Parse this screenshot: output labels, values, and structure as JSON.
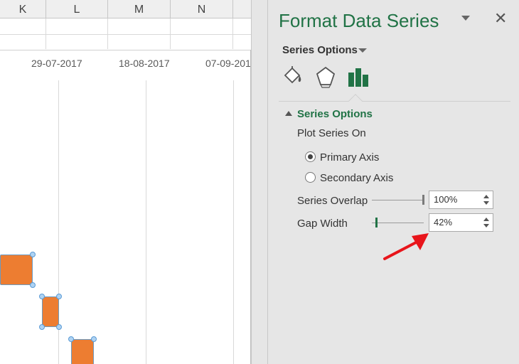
{
  "sheet": {
    "columns": [
      "K",
      "L",
      "M",
      "N"
    ],
    "chart": {
      "date_labels": [
        "29-07-2017",
        "18-08-2017",
        "07-09-201"
      ]
    },
    "colors": {
      "bar": "#ed7d31",
      "handle": "#5b9bd5"
    }
  },
  "pane": {
    "title": "Format Data Series",
    "close_glyph": "✕",
    "series_options_dropdown": "Series Options",
    "tabs": [
      {
        "name": "fill-line",
        "icon": "paint-bucket-icon"
      },
      {
        "name": "effects",
        "icon": "pentagon-icon"
      },
      {
        "name": "series-options",
        "icon": "bar-chart-icon",
        "active": true
      }
    ],
    "section": {
      "title": "Series Options",
      "plot_series_on_label": "Plot Series On",
      "primary_axis_label": "Primary Axis",
      "secondary_axis_label": "Secondary Axis",
      "primary_selected": true,
      "series_overlap": {
        "label": "Series Overlap",
        "value": "100%",
        "level": 1.0
      },
      "gap_width": {
        "label": "Gap Width",
        "value": "42%",
        "level": 0.08
      }
    },
    "colors": {
      "accent": "#217346",
      "annotation_arrow": "#e8151b"
    }
  }
}
